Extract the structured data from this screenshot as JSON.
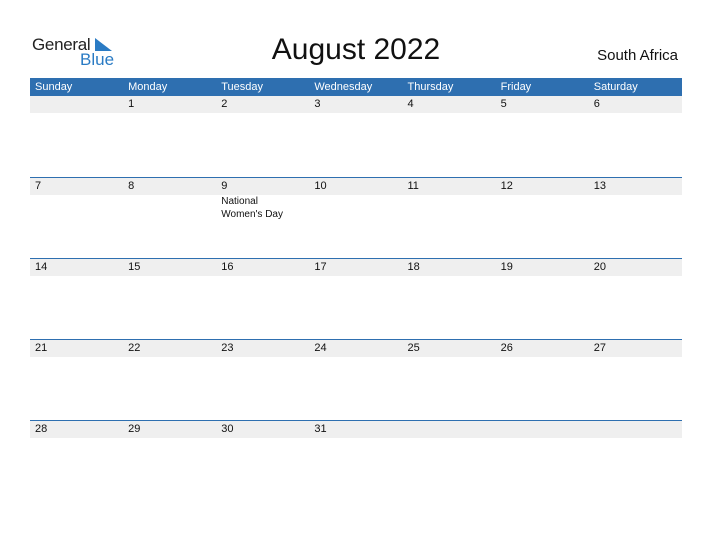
{
  "logo": {
    "word1": "General",
    "word2": "Blue",
    "icon": "blue-triangle-flag-icon",
    "accent": "#2a7bc4"
  },
  "title": "August 2022",
  "country": "South Africa",
  "colors": {
    "header_bg": "#2e6fb0",
    "band_bg": "#efefef"
  },
  "weekdays": [
    "Sunday",
    "Monday",
    "Tuesday",
    "Wednesday",
    "Thursday",
    "Friday",
    "Saturday"
  ],
  "weeks": [
    {
      "days": [
        "",
        "1",
        "2",
        "3",
        "4",
        "5",
        "6"
      ],
      "events": [
        "",
        "",
        "",
        "",
        "",
        "",
        ""
      ]
    },
    {
      "days": [
        "7",
        "8",
        "9",
        "10",
        "11",
        "12",
        "13"
      ],
      "events": [
        "",
        "",
        "National Women's Day",
        "",
        "",
        "",
        ""
      ]
    },
    {
      "days": [
        "14",
        "15",
        "16",
        "17",
        "18",
        "19",
        "20"
      ],
      "events": [
        "",
        "",
        "",
        "",
        "",
        "",
        ""
      ]
    },
    {
      "days": [
        "21",
        "22",
        "23",
        "24",
        "25",
        "26",
        "27"
      ],
      "events": [
        "",
        "",
        "",
        "",
        "",
        "",
        ""
      ]
    },
    {
      "days": [
        "28",
        "29",
        "30",
        "31",
        "",
        "",
        ""
      ],
      "events": [
        "",
        "",
        "",
        "",
        "",
        "",
        ""
      ]
    }
  ]
}
